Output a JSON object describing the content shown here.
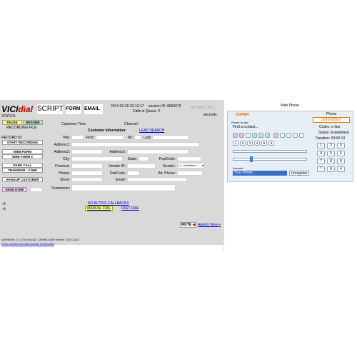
{
  "agent": {
    "logo_part1": "VICI",
    "logo_part2": "dial",
    "tabs": {
      "script": "SCRIPT",
      "form": "FORM",
      "email": "EMAIL"
    },
    "datetime": "2014-03-26 02:12:17",
    "session": "session ID: 8660079",
    "calls_in_queue": "Calls in Queue: 0",
    "no_live_call": "NO LIVE CALL",
    "sec_info": "seconds",
    "status_label": "STATUS:",
    "pause_label": "PAUSE",
    "resume_label": "RESUME",
    "recording_file": "RECORDING FILE",
    "record_id": "RECORD ID:",
    "start_recording": "START RECORDING",
    "web_form": "WEB FORM",
    "web_form_2": "WEB FORM 2",
    "park_call": "PARK CALL",
    "transfer_conf": "TRANSFER - CONF",
    "hangup_customer": "HANGUP CUSTOMER",
    "send_dtmf": "SEND DTMF",
    "customer_time": "Customer Time:",
    "channel": "Channel:",
    "customer_information": "Customer Information:",
    "lead_search": "LEAD SEARCH",
    "fields": {
      "title": "Title:",
      "first": "First:",
      "mi": "MI:",
      "last": "Last:",
      "address1": "Address1:",
      "address2": "Address2:",
      "address3": "Address3:",
      "city": "City:",
      "state": "State:",
      "postcode": "PostCode:",
      "province": "Province:",
      "vendor_id": "Vendor ID:",
      "gender": "Gender:",
      "gender_value": "U - Undefined",
      "phone": "Phone:",
      "dialcode": "DialCode:",
      "alt_phone": "Alt. Phone:",
      "show": "Show:",
      "email": "Email:",
      "comments": "Comments:"
    },
    "no_active_callbacks": "NO ACTIVE CALLBACKS",
    "manual_dial": "MANUAL DIAL",
    "fast_dial": "FAST DIAL",
    "mute": "MUTE",
    "agents_view": "Agents View +",
    "version": "VERSION: 2.7-370c   BUILD: 130906-0339    Server: 10.0.0.243",
    "conference_link": "Show conference call channel information"
  },
  "webphone": {
    "title": "Web Phone",
    "brand": "ZOIPER",
    "phone_to_dial": "Phone to dial",
    "find_contact": "Find a contact...",
    "account_label": "Account",
    "account_value": "Your Phone",
    "unregister": "Unregister",
    "status_phone": "Phone",
    "status_number": "9999999999",
    "codec": "Codec: u-law",
    "status": "Status: Established",
    "duration": "Duration: 00:00:13",
    "keypad": [
      "1",
      "2",
      "3",
      "4",
      "5",
      "6",
      "7",
      "8",
      "9",
      "*",
      "0",
      "#"
    ]
  }
}
